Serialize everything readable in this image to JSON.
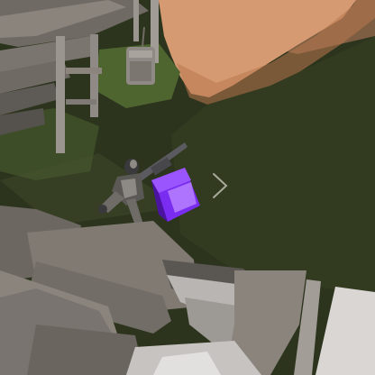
{
  "scene": {
    "description_free": true,
    "palette": {
      "sky": "#b7855c",
      "hill_light": "#d59a72",
      "hill_shadow": "#c8865e",
      "ground_dark": "#2c341d",
      "ground_mid": "#3b4626",
      "grass_light": "#4f6530",
      "wood_light": "#8a847d",
      "wood_mid": "#6f6a64",
      "wood_dark": "#4d4a46",
      "pole": "#9a958f",
      "lantern": "#8f8a85",
      "rock_light": "#d9d6d3",
      "rock_mid": "#b8b5b2",
      "item_purple": "#7a2cf0",
      "item_purple_dark": "#4a14a0",
      "item_highlight": "#b47cff",
      "character_dark": "#3a3a3c",
      "character_light": "#8d8a86",
      "gun": "#5a5a60"
    },
    "icons": [
      "chevron-right-icon"
    ]
  }
}
